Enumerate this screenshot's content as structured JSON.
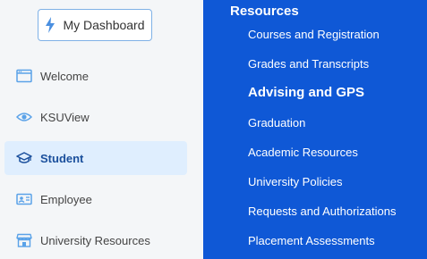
{
  "dashboard_button": {
    "label": "My Dashboard"
  },
  "sidebar": {
    "items": [
      {
        "label": "Welcome",
        "icon": "browser-window-icon"
      },
      {
        "label": "KSUView",
        "icon": "eye-icon"
      },
      {
        "label": "Student",
        "icon": "graduation-cap-icon",
        "active": true
      },
      {
        "label": "Employee",
        "icon": "id-card-icon"
      },
      {
        "label": "University Resources",
        "icon": "storefront-icon"
      }
    ]
  },
  "resources": {
    "title": "Resources",
    "links": [
      "Courses and Registration",
      "Grades and Transcripts",
      "Advising and GPS",
      "Graduation",
      "Academic Resources",
      "University Policies",
      "Requests and Authorizations",
      "Placement Assessments"
    ]
  },
  "colors": {
    "accent": "#0f58d6",
    "icon_blue": "#5aa2e8",
    "active_bg": "#dfeefe",
    "active_text": "#1a4f9c"
  }
}
